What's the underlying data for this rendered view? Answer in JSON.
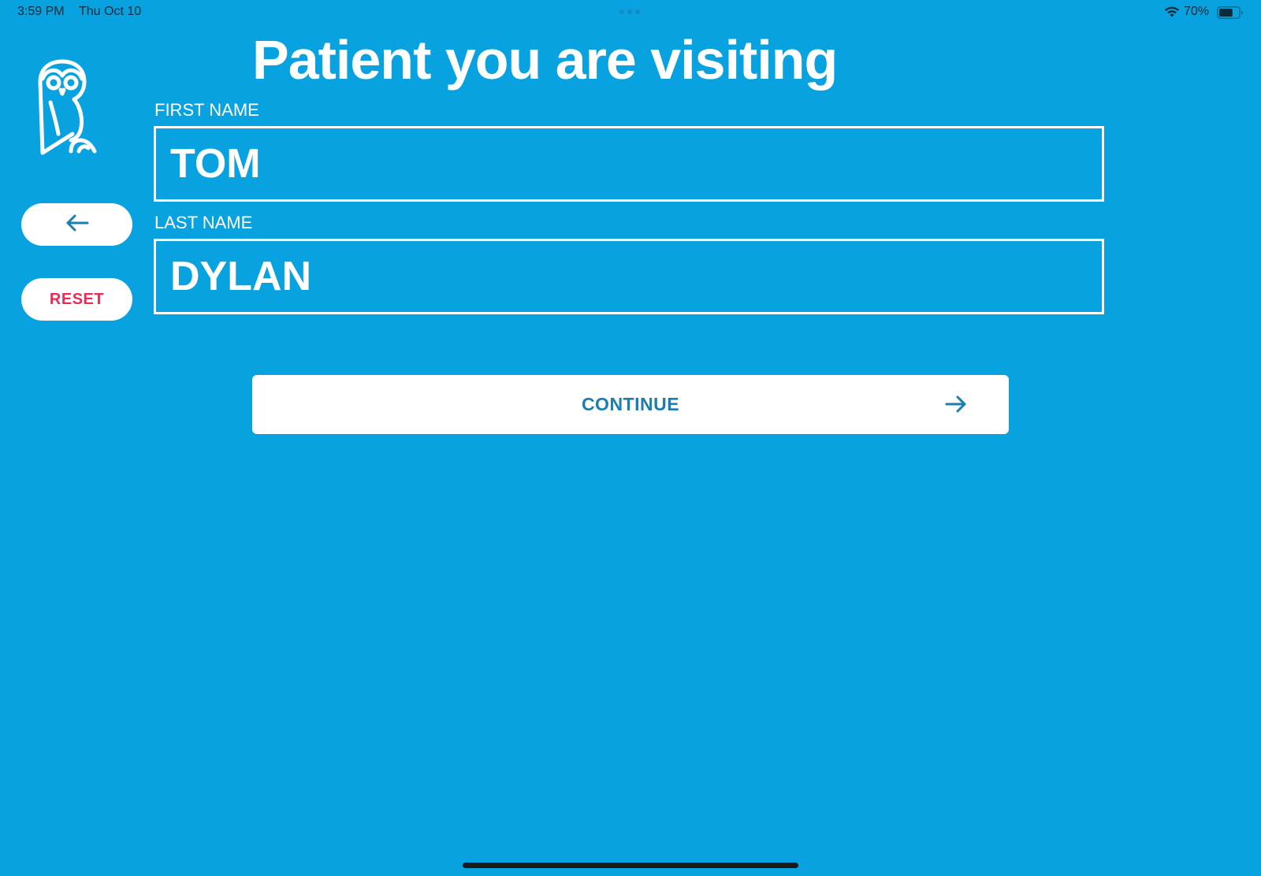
{
  "status_bar": {
    "time": "3:59 PM",
    "date": "Thu Oct 10",
    "battery_percent": "70%",
    "battery_level": 0.7,
    "wifi_icon": "wifi-icon",
    "battery_icon": "battery-icon"
  },
  "header": {
    "title": "Patient you are visiting",
    "logo_icon": "owl-icon"
  },
  "sidebar": {
    "back_icon": "arrow-left-icon",
    "reset_label": "RESET"
  },
  "form": {
    "first_name": {
      "label": "FIRST NAME",
      "value": "TOM"
    },
    "last_name": {
      "label": "LAST NAME",
      "value": "DYLAN"
    }
  },
  "actions": {
    "continue_label": "CONTINUE",
    "continue_icon": "arrow-right-icon"
  },
  "colors": {
    "background": "#07a2df",
    "accent_text": "#1a7eb0",
    "reset_text": "#ee2a55",
    "white": "#ffffff"
  }
}
